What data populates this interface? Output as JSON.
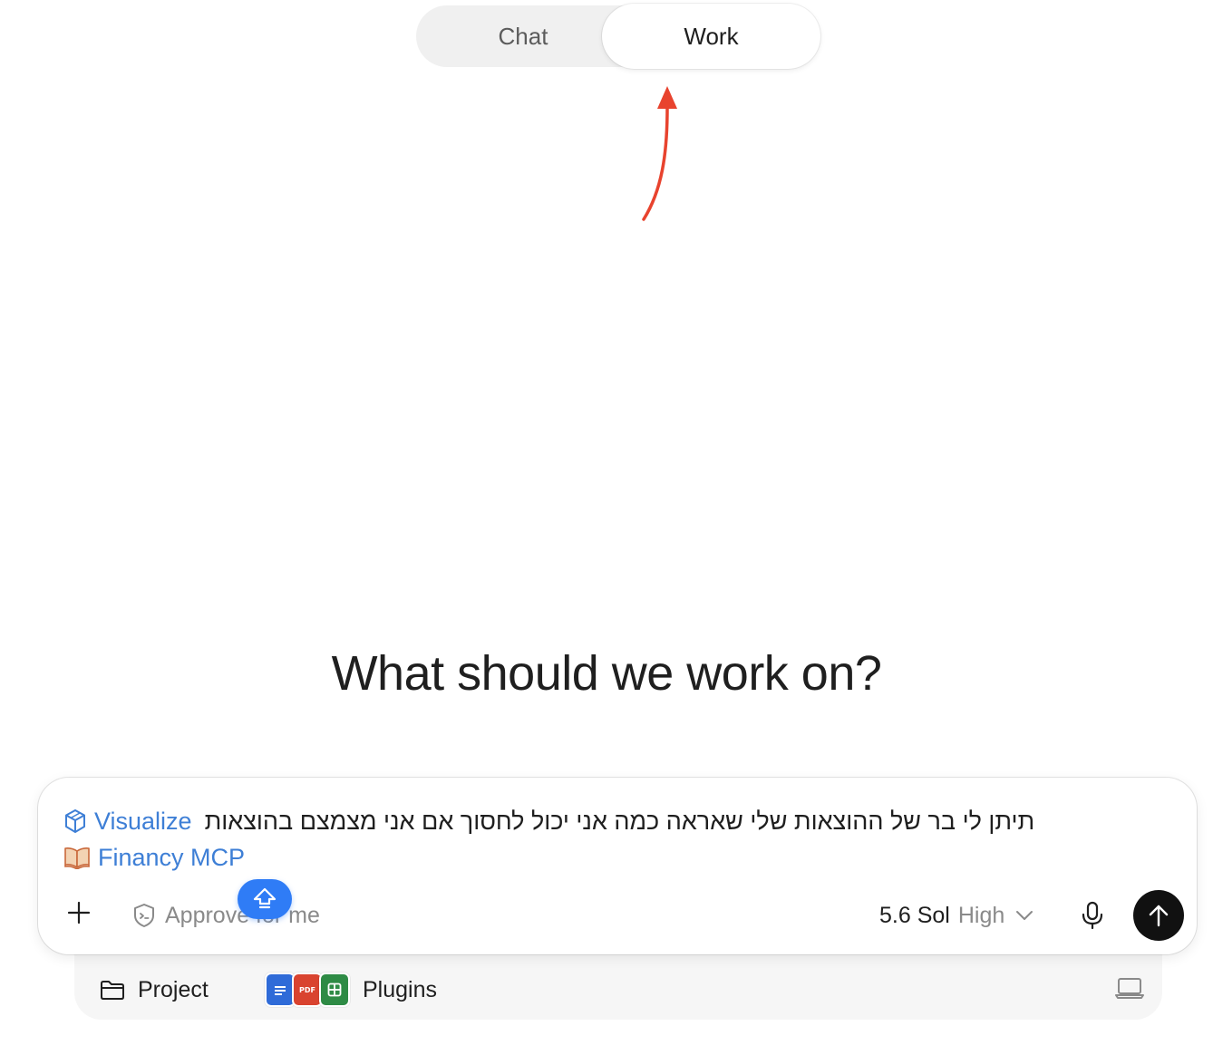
{
  "mode_toggle": {
    "tabs": [
      {
        "label": "Chat",
        "active": false
      },
      {
        "label": "Work",
        "active": true
      }
    ]
  },
  "headline": "What should we work on?",
  "composer": {
    "chips": [
      {
        "label": "Visualize",
        "icon": "cube-icon"
      },
      {
        "label": "Financy MCP",
        "icon": "book-icon"
      }
    ],
    "prompt_text": "תיתן לי בר של ההוצאות שלי שאראה כמה אני יכול לחסוך אם אני מצמצם בהוצאות",
    "approve_label": "Approve for me",
    "model_name": "5.6 Sol",
    "model_effort": "High"
  },
  "tray": {
    "project_label": "Project",
    "plugins_label": "Plugins",
    "plugin_icons": [
      "docs-icon",
      "pdf-icon",
      "sheets-icon"
    ],
    "pdf_badge_text": "PDF"
  },
  "colors": {
    "accent_link": "#3e7fd6",
    "annotation_arrow": "#e8432e",
    "shift_badge": "#2f7cf6",
    "send_button": "#111111"
  }
}
